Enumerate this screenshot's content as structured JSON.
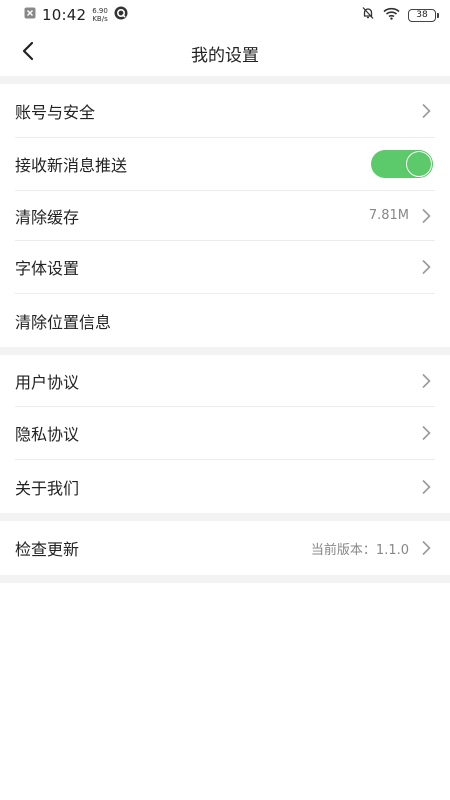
{
  "status_bar": {
    "time": "10:42",
    "net_speed_value": "6.90",
    "net_speed_unit": "KB/s",
    "battery_level": "38",
    "icons": [
      "notification-close-icon",
      "app-q-icon",
      "mute-bell-icon",
      "wifi-icon",
      "battery-icon"
    ]
  },
  "header": {
    "title": "我的设置",
    "back_icon": "back-chevron-icon"
  },
  "groups": [
    {
      "items": [
        {
          "label": "账号与安全",
          "type": "link"
        },
        {
          "label": "接收新消息推送",
          "type": "toggle",
          "enabled": true
        },
        {
          "label": "清除缓存",
          "type": "link",
          "value": "7.81M"
        },
        {
          "label": "字体设置",
          "type": "link"
        },
        {
          "label": "清除位置信息",
          "type": "action"
        }
      ]
    },
    {
      "items": [
        {
          "label": "用户协议",
          "type": "link"
        },
        {
          "label": "隐私协议",
          "type": "link"
        },
        {
          "label": "关于我们",
          "type": "link"
        }
      ]
    },
    {
      "items": [
        {
          "label": "检查更新",
          "type": "link",
          "value": "当前版本：1.1.0"
        }
      ]
    }
  ],
  "colors": {
    "toggle_on": "#5cc96a",
    "separator_band": "#f3f3f3",
    "divider": "#ececec",
    "secondary_text": "#888888",
    "chevron": "#9a9a9a"
  }
}
